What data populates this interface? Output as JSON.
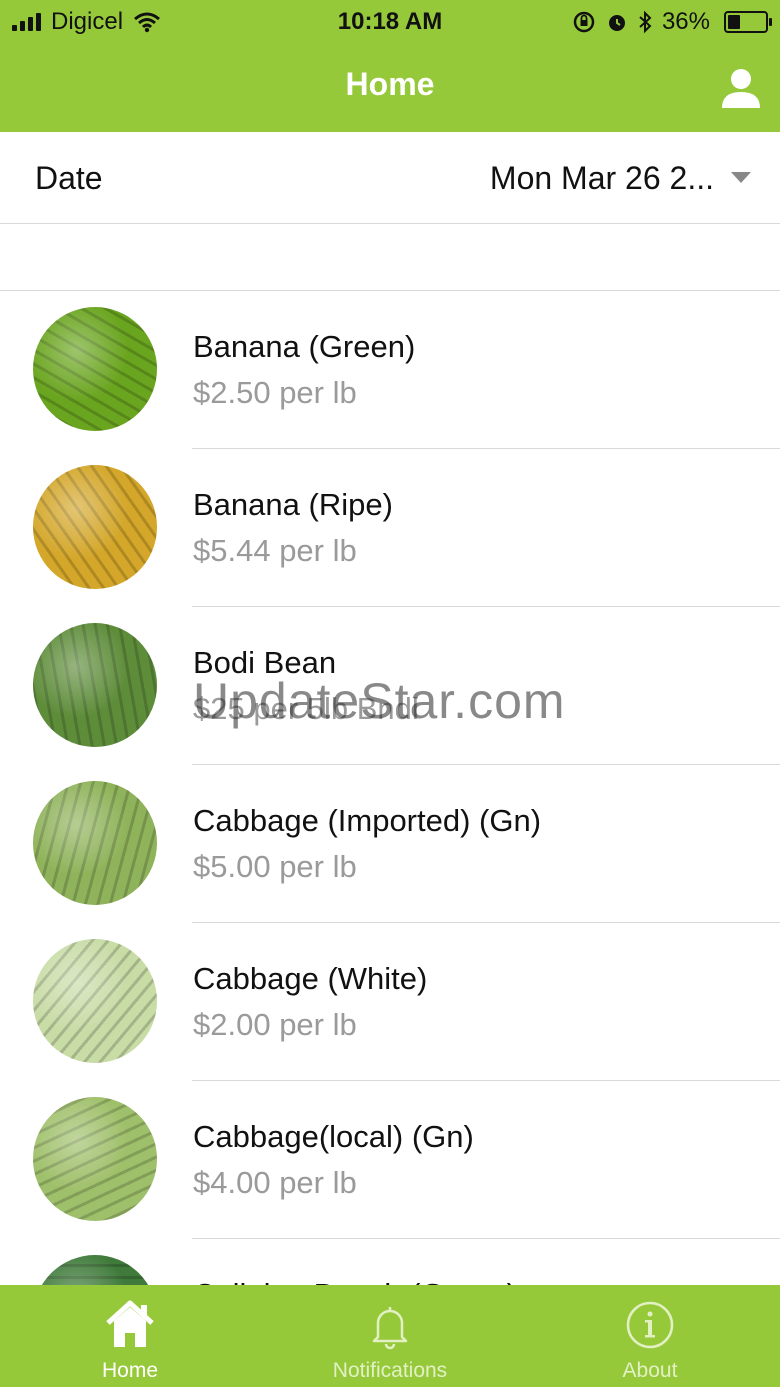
{
  "status_bar": {
    "carrier": "Digicel",
    "time": "10:18 AM",
    "battery_percent": "36%",
    "battery_level": 0.36,
    "icons": [
      "signal-bars-icon",
      "wifi-icon",
      "orientation-lock-icon",
      "alarm-icon",
      "bluetooth-icon",
      "battery-icon"
    ]
  },
  "nav": {
    "title": "Home",
    "profile_icon": "user-icon"
  },
  "date_filter": {
    "label": "Date",
    "value": "Mon Mar 26 2..."
  },
  "items": [
    {
      "name": "Banana (Green)",
      "price": "$2.50 per lb",
      "image": "green-banana",
      "color": "#6aa51f"
    },
    {
      "name": "Banana (Ripe)",
      "price": "$5.44 per lb",
      "image": "ripe-banana",
      "color": "#d4a72a"
    },
    {
      "name": "Bodi Bean",
      "price": "$25 per 5lb Bndl",
      "image": "bodi-bean",
      "color": "#5e8d3a"
    },
    {
      "name": "Cabbage (Imported) (Gn)",
      "price": "$5.00 per lb",
      "image": "cabbage-imported",
      "color": "#8fb35a"
    },
    {
      "name": "Cabbage (White)",
      "price": "$2.00 per lb",
      "image": "cabbage-white",
      "color": "#c8dca6"
    },
    {
      "name": "Cabbage(local) (Gn)",
      "price": "$4.00 per lb",
      "image": "cabbage-local",
      "color": "#9fc06a"
    },
    {
      "name": "Callaloo Bunch (Green)",
      "price": "",
      "image": "callaloo",
      "color": "#3f7a3a"
    }
  ],
  "watermark": "UpdateStar.com",
  "tabs": [
    {
      "label": "Home",
      "icon": "home-icon",
      "active": true
    },
    {
      "label": "Notifications",
      "icon": "bell-icon",
      "active": false
    },
    {
      "label": "About",
      "icon": "info-icon",
      "active": false
    }
  ],
  "colors": {
    "brand_green": "#96c93a",
    "price_gray": "#9a9a9a"
  }
}
